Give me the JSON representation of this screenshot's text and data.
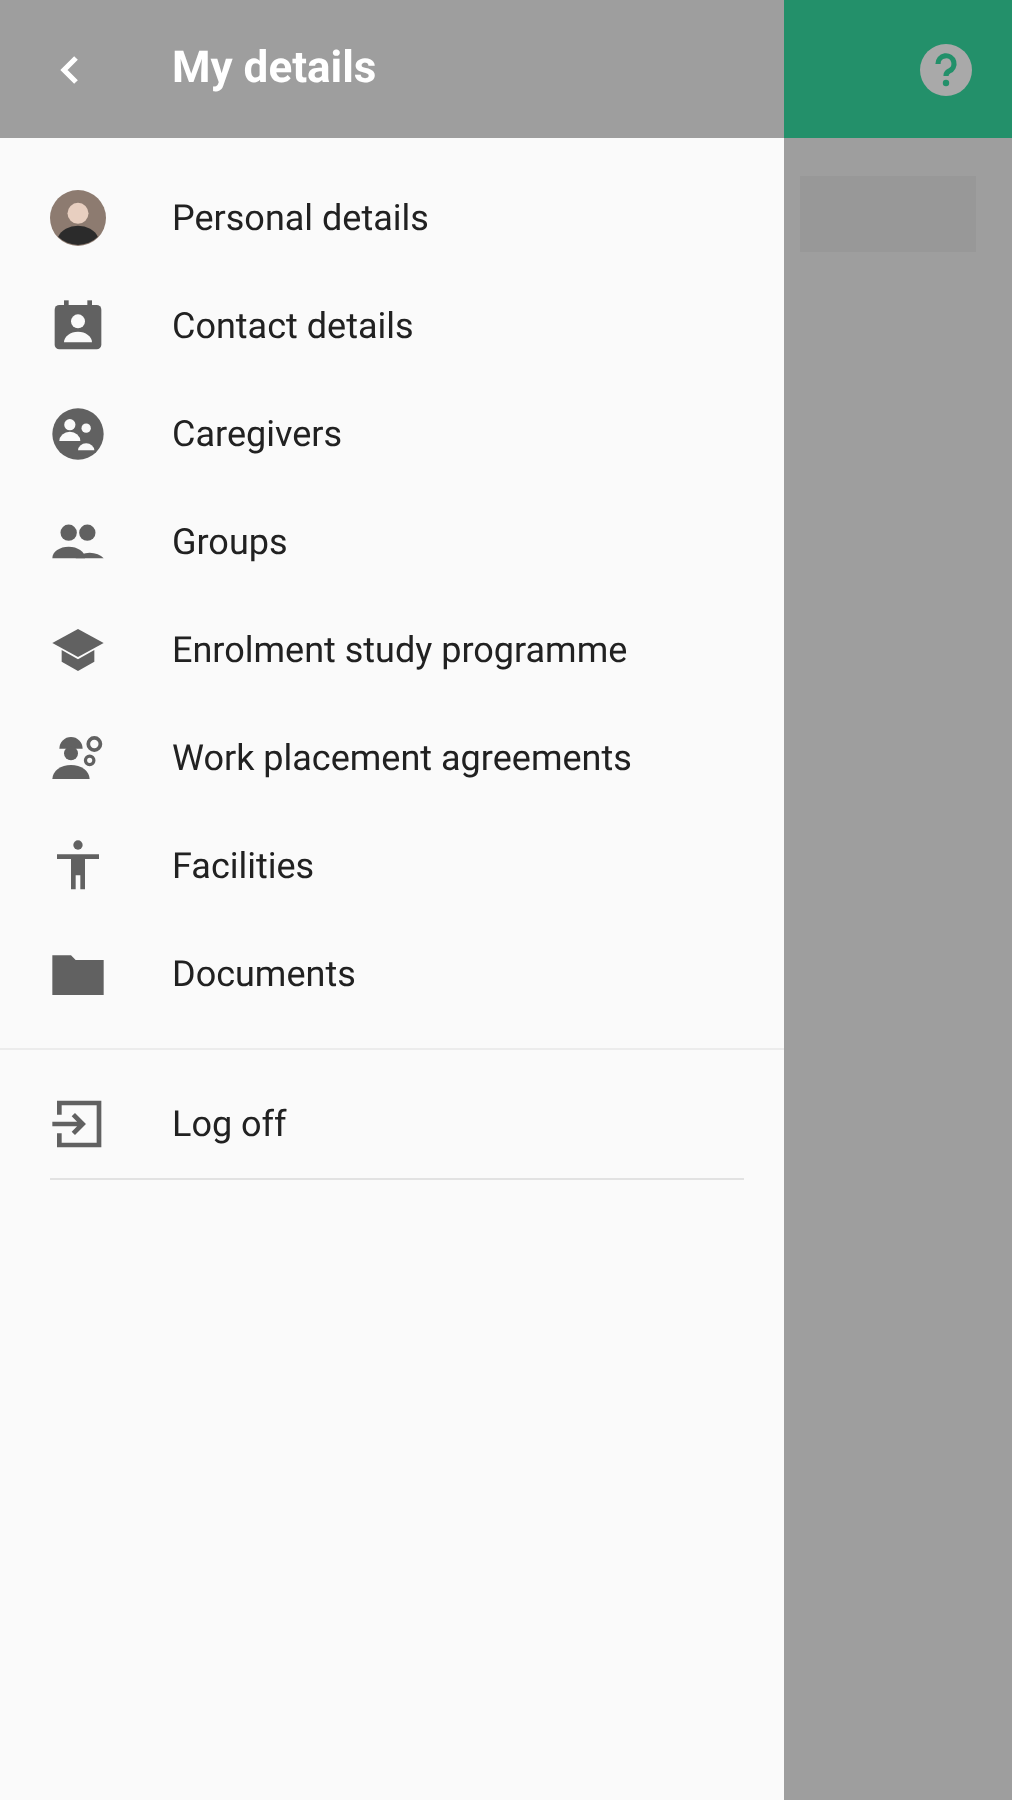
{
  "drawer": {
    "title": "My details",
    "items": [
      {
        "label": "Personal details"
      },
      {
        "label": "Contact details"
      },
      {
        "label": "Caregivers"
      },
      {
        "label": "Groups"
      },
      {
        "label": "Enrolment study programme"
      },
      {
        "label": "Work placement agreements"
      },
      {
        "label": "Facilities"
      },
      {
        "label": "Documents"
      }
    ],
    "footer_items": [
      {
        "label": "Log off"
      }
    ]
  }
}
